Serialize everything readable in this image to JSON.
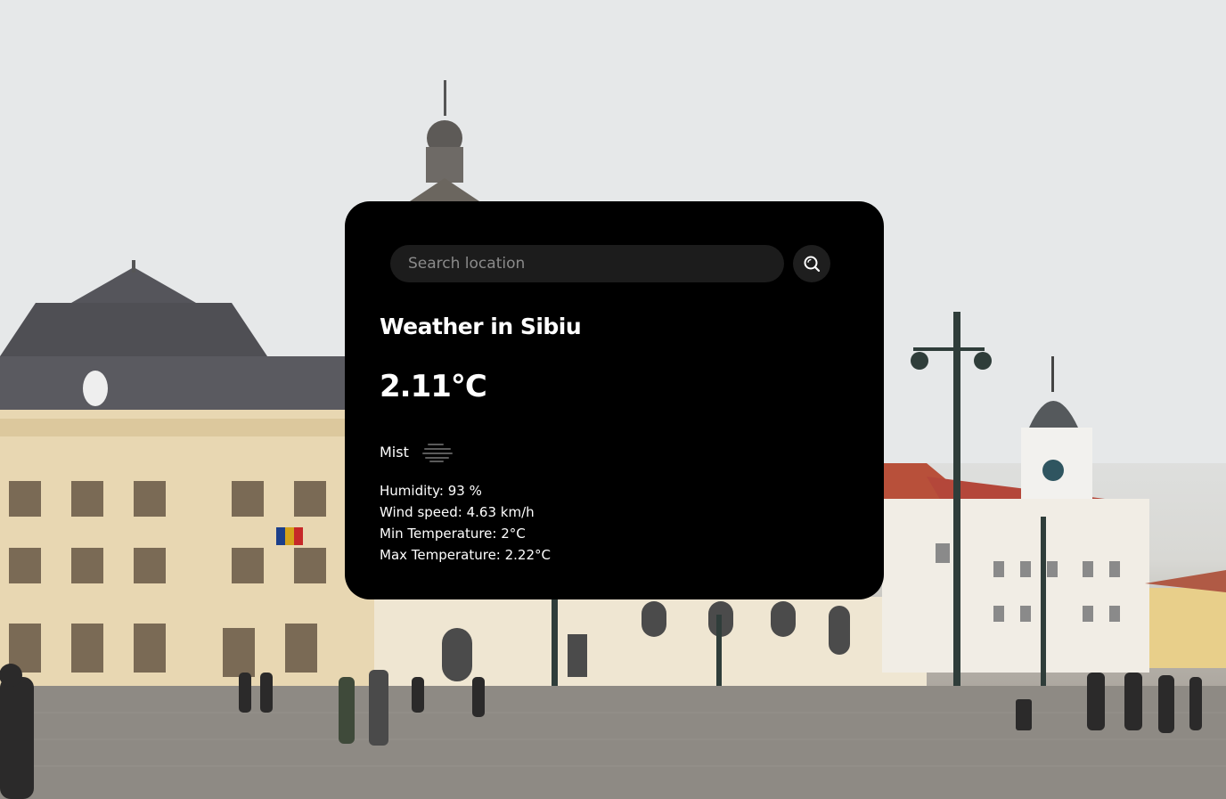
{
  "search": {
    "placeholder": "Search location",
    "value": ""
  },
  "weather": {
    "title": "Weather in Sibiu",
    "temperature": "2.11°C",
    "condition": "Mist",
    "condition_icon": "mist-icon",
    "details": {
      "humidity": "Humidity: 93 %",
      "wind_speed": "Wind speed: 4.63 km/h",
      "min_temperature": "Min Temperature: 2°C",
      "max_temperature": "Max Temperature: 2.22°C"
    }
  },
  "colors": {
    "card_background": "#000000",
    "text": "#ffffff",
    "input_background": "#1c1c1c",
    "button_background": "#1e1e1e"
  }
}
